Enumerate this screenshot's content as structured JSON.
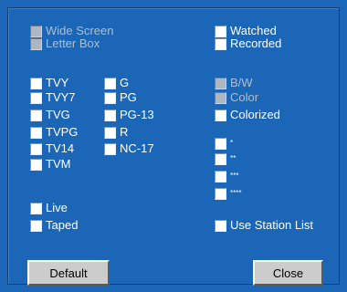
{
  "colors": {
    "panel_bg": "#1b66b7",
    "label_enabled": "#ffffff",
    "label_disabled": "#b3bec9",
    "button_face": "#cccccc"
  },
  "format": [
    {
      "label": "Wide Screen",
      "enabled": false
    },
    {
      "label": "Letter Box",
      "enabled": false
    }
  ],
  "status": [
    {
      "label": "Watched",
      "enabled": true
    },
    {
      "label": "Recorded",
      "enabled": true
    }
  ],
  "tv_ratings": [
    {
      "label": "TVY",
      "enabled": true
    },
    {
      "label": "TVY7",
      "enabled": true
    },
    {
      "label": "TVG",
      "enabled": true
    },
    {
      "label": "TVPG",
      "enabled": true
    },
    {
      "label": "TV14",
      "enabled": true
    },
    {
      "label": "TVM",
      "enabled": true
    }
  ],
  "movie_ratings": [
    {
      "label": "G",
      "enabled": true
    },
    {
      "label": "PG",
      "enabled": true
    },
    {
      "label": "PG-13",
      "enabled": true
    },
    {
      "label": "R",
      "enabled": true
    },
    {
      "label": "NC-17",
      "enabled": true
    }
  ],
  "color_modes": [
    {
      "label": "B/W",
      "enabled": false
    },
    {
      "label": "Color",
      "enabled": false
    },
    {
      "label": "Colorized",
      "enabled": true
    }
  ],
  "star_ratings": [
    {
      "label": "*",
      "enabled": true
    },
    {
      "label": "**",
      "enabled": true
    },
    {
      "label": "***",
      "enabled": true
    },
    {
      "label": "****",
      "enabled": true
    }
  ],
  "broadcast": [
    {
      "label": "Live",
      "enabled": true
    },
    {
      "label": "Taped",
      "enabled": true
    }
  ],
  "use_station_list": {
    "label": "Use Station List",
    "enabled": true
  },
  "buttons": {
    "default_label": "Default",
    "close_label": "Close"
  }
}
